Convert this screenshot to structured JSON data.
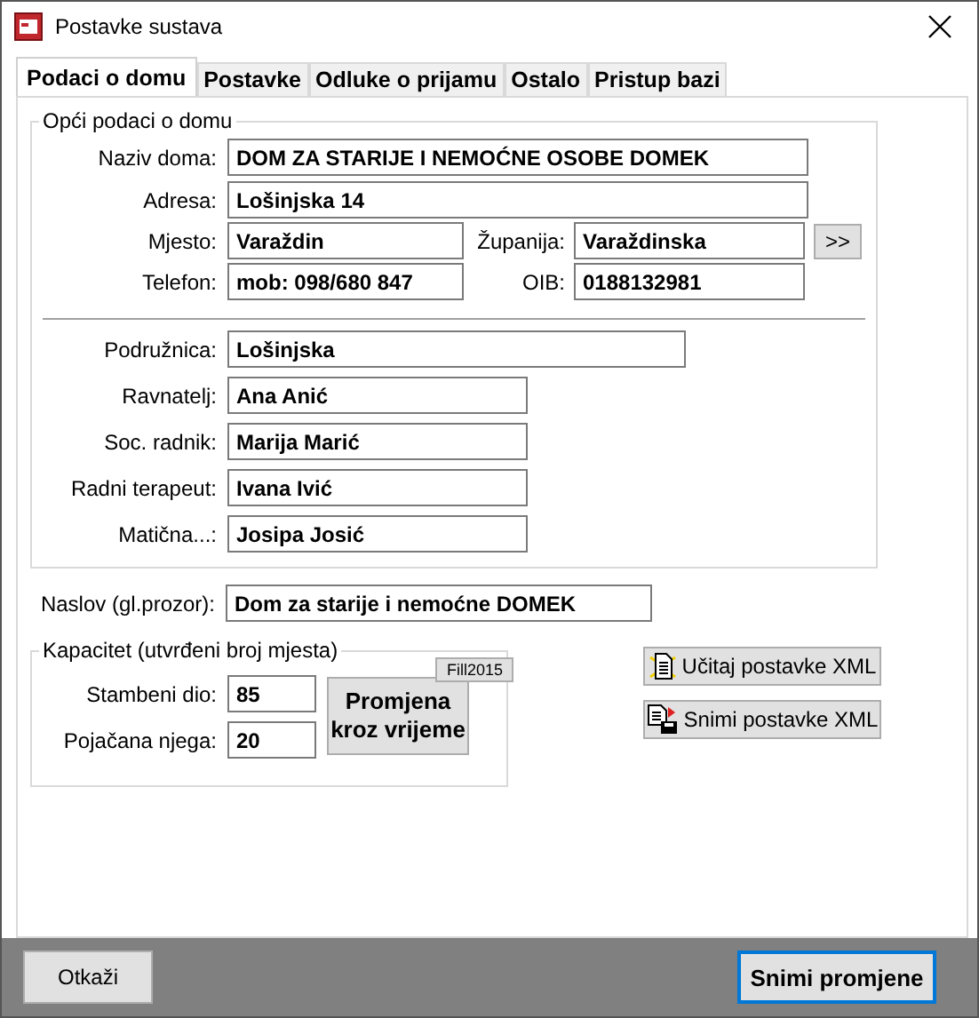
{
  "window": {
    "title": "Postavke sustava"
  },
  "tabs": [
    {
      "label": "Podaci o domu",
      "selected": true
    },
    {
      "label": "Postavke",
      "selected": false
    },
    {
      "label": "Odluke o prijamu",
      "selected": false
    },
    {
      "label": "Ostalo",
      "selected": false
    },
    {
      "label": "Pristup bazi",
      "selected": false
    }
  ],
  "general": {
    "title": "Opći podaci o domu",
    "fields": [
      {
        "label": "Naziv doma:",
        "value": "DOM ZA STARIJE I NEMOĆNE OSOBE DOMEK"
      },
      {
        "label": "Adresa:",
        "value": "Lošinjska 14"
      }
    ],
    "pairs": [
      {
        "left": {
          "label": "Mjesto:",
          "value": "Varaždin"
        },
        "right": {
          "label": "Županija:",
          "value": "Varaždinska"
        },
        "button": ">>"
      },
      {
        "left": {
          "label": "Telefon:",
          "value": "mob: 098/680 847"
        },
        "right": {
          "label": "OIB:",
          "value": "0188132981"
        }
      }
    ],
    "staff": [
      {
        "kind": "wide",
        "label": "Podružnica:",
        "value": "Lošinjska"
      },
      {
        "kind": "short",
        "label": "Ravnatelj:",
        "value": "Ana Anić"
      },
      {
        "kind": "short",
        "label": "Soc. radnik:",
        "value": "Marija Marić"
      },
      {
        "kind": "short",
        "label": "Radni terapeut:",
        "value": "Ivana Ivić"
      },
      {
        "kind": "short",
        "label": "Matična...:",
        "value": "Josipa Josić"
      }
    ]
  },
  "title_field": {
    "label": "Naslov (gl.prozor):",
    "value": "Dom za starije i nemoćne DOMEK"
  },
  "capacity": {
    "title": "Kapacitet (utvrđeni broj mjesta)",
    "badge": "Fill2015",
    "fields": [
      {
        "label": "Stambeni dio:",
        "value": "85"
      },
      {
        "label": "Pojačana njega:",
        "value": "20"
      }
    ],
    "button": "Promjena kroz vrijeme"
  },
  "xml_buttons": [
    {
      "kind": "load",
      "label": "Učitaj postavke XML"
    },
    {
      "kind": "save",
      "label": "Snimi postavke XML"
    }
  ],
  "footer": [
    {
      "label": "Otkaži",
      "default": false
    },
    {
      "label": "Snimi promjene",
      "default": true
    }
  ]
}
